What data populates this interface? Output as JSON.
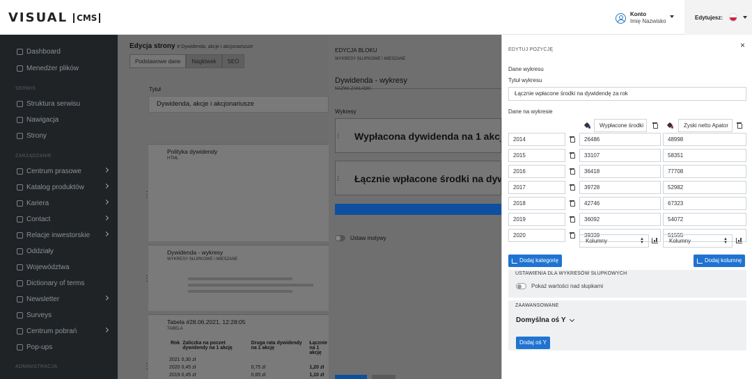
{
  "app": {
    "logo_main": "VISUAL",
    "logo_box": "CMS"
  },
  "header": {
    "account_label": "Konto",
    "account_name": "Imię Nazwisko",
    "editing_label": "Edytujesz:"
  },
  "sidebar": {
    "sections": {
      "serwis": "SERWIS",
      "zarzadzanie": "ZARZĄDZANIE",
      "administracja": "ADMINISTRACJA"
    },
    "items": [
      {
        "label": "Dashboard"
      },
      {
        "label": "Menedżer plików"
      },
      {
        "label": "Struktura serwisu"
      },
      {
        "label": "Nawigacja"
      },
      {
        "label": "Strony"
      },
      {
        "label": "Centrum prasowe"
      },
      {
        "label": "Katalog produktów"
      },
      {
        "label": "Kariera"
      },
      {
        "label": "Contact"
      },
      {
        "label": "Relacje inwestorskie"
      },
      {
        "label": "Oddziały"
      },
      {
        "label": "Województwa"
      },
      {
        "label": "Dictionary of terms"
      },
      {
        "label": "Newsletter"
      },
      {
        "label": "Surveys"
      },
      {
        "label": "Centrum pobrań"
      },
      {
        "label": "Pop-ups"
      }
    ]
  },
  "main": {
    "title": "Edycja strony",
    "subtitle": "# Dywidenda, akcje i akcjonariusze",
    "tabs": [
      "Podstawowe dane",
      "Nagłówek",
      "SEO"
    ],
    "title_label": "Tytuł",
    "title_value": "Dywidenda, akcje i akcjonariusze",
    "cards": [
      {
        "title": "Polityka dywidendy",
        "type": "HTML"
      },
      {
        "title": "Dywidenda - wykresy",
        "type": "WYKRESY SŁUPKOWE I MIESZANE"
      },
      {
        "title": "Tabela #28.06.2021, 12:28:05",
        "type": "TABELA"
      }
    ],
    "table": {
      "headers": [
        "Rok",
        "Zaliczka na poczet dywidendy na 1 akcję",
        "Druga rata dywidendy na 1 akcję",
        "Łącznie na 1 akcję"
      ],
      "rows": [
        [
          "2021",
          "0,30 zł",
          "",
          ""
        ],
        [
          "2020",
          "0,45 zł",
          "0,75 zł",
          "1,20 zł"
        ],
        [
          "2019",
          "0,45 zł",
          "0,65 zł",
          "1,10 zł"
        ]
      ]
    }
  },
  "block": {
    "heading": "EDYCJA BLOKU",
    "subheading": "WYKRESY SŁUPKOWE I MIESZANE",
    "name_value": "Dywidenda - wykresy",
    "name_label": "NAZWA ZAKŁADKI",
    "charts_label": "Wykresy",
    "chart1": "Wypłacona dywidenda na 1 akcję",
    "chart2": "Łącznie wpłacone środki na dywidendę",
    "toggle_label": "Ustaw motywy"
  },
  "panel": {
    "heading": "EDYTUJ POZYCJĘ",
    "close": "×",
    "data_label": "Dane wykresu",
    "title_label": "Tytuł wykresu",
    "title_value": "Łącznie wpłacone środki na dywidendę za rok",
    "on_chart_label": "Dane na wykresie",
    "series": [
      "Wypłacone środki",
      "Zyski netto Apator"
    ],
    "series_colors": [
      "#1a3a8c",
      "#d4213d"
    ],
    "rows": [
      {
        "year": "2014",
        "a": "26486",
        "b": "48998"
      },
      {
        "year": "2015",
        "a": "33107",
        "b": "58351"
      },
      {
        "year": "2016",
        "a": "36418",
        "b": "77708"
      },
      {
        "year": "2017",
        "a": "39728",
        "b": "52982"
      },
      {
        "year": "2018",
        "a": "42746",
        "b": "67323"
      },
      {
        "year": "2019",
        "a": "36092",
        "b": "54072"
      },
      {
        "year": "2020",
        "a": "39339",
        "b": "51555"
      }
    ],
    "type_a": "Kolumny",
    "type_b": "Kolumny",
    "add_category": "Dodaj kategorię",
    "add_column": "Dodaj kolumnę",
    "bar_settings_title": "USTAWIENIA DLA WYKRESÓW SŁUPKOWYCH",
    "show_values_label": "Pokaż wartości nad słupkami",
    "advanced_title": "ZAAWANSOWANE",
    "default_axis": "Domyślna oś Y",
    "add_axis": "Dodaj oś Y"
  }
}
